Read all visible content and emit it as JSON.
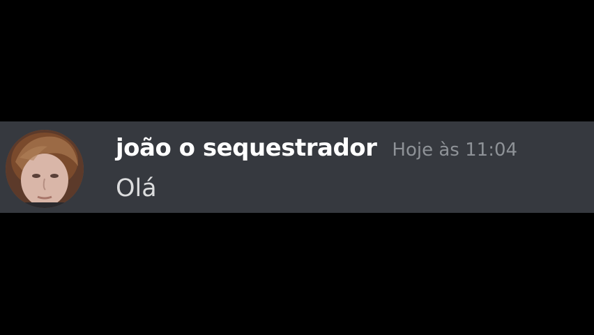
{
  "message": {
    "author": "joão o sequestrador",
    "timestamp": "Hoje às 11:04",
    "content": "Olá",
    "avatar_icon": "user-avatar-photo"
  },
  "colors": {
    "background": "#000000",
    "message_background": "#36393f",
    "username": "#ffffff",
    "timestamp": "#8e9297",
    "content": "#dcddde"
  }
}
